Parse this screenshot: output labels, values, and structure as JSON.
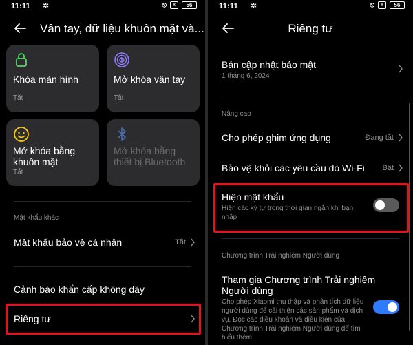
{
  "left": {
    "status": {
      "time": "11:11",
      "battery": "56"
    },
    "title": "Vân tay, dữ liệu khuôn mặt và...",
    "tiles": [
      {
        "label": "Khóa màn hình",
        "status": "Tắt",
        "icon": "lock-icon"
      },
      {
        "label": "Mở khóa vân tay",
        "status": "Tắt",
        "icon": "fingerprint-icon"
      },
      {
        "label": "Mở khóa bằng khuôn mặt",
        "status": "Tắt",
        "icon": "face-icon"
      },
      {
        "label": "Mở khóa bằng thiết bị Bluetooth",
        "icon": "bluetooth-icon"
      }
    ],
    "section_other": "Mật khẩu khác",
    "personal_password": {
      "label": "Mật khẩu bảo vệ cá nhân",
      "value": "Tắt"
    },
    "wireless_alert": {
      "label": "Cảnh báo khẩn cấp không dây"
    },
    "privacy": {
      "label": "Riêng tư"
    }
  },
  "right": {
    "status": {
      "time": "11:11",
      "battery": "56"
    },
    "title": "Riêng tư",
    "security_update": {
      "label": "Bản cập nhật bảo mật",
      "sub": "1 tháng 6, 2024"
    },
    "section_advanced": "Nâng cao",
    "app_pinning": {
      "label": "Cho phép ghim ứng dụng",
      "value": "Đang tắt"
    },
    "wifi_protect": {
      "label": "Bảo vệ khỏi các yêu cầu dò Wi-Fi",
      "value": "Bật"
    },
    "show_password": {
      "label": "Hiện mật khẩu",
      "sub": "Hiện các ký tự trong thời gian ngắn khi bạn nhập",
      "enabled": false
    },
    "section_ux": "Chương trình Trải nghiệm Người dùng",
    "join_program": {
      "label": "Tham gia Chương trình Trải nghiệm Người dùng",
      "sub": "Cho phép Xiaomi thu thập và phân tích dữ liệu người dùng để cải thiện các sản phẩm và dịch vụ. Đọc các điều khoản và điều kiện của Chương trình Trải nghiệm Người dùng để tìm hiểu thêm.",
      "enabled": true
    }
  },
  "colors": {
    "highlight": "#e0141e",
    "accent": "#2f7bff",
    "tile_icon_green": "#4cd964",
    "tile_icon_yellow": "#f5c518",
    "tile_icon_purple": "#8f7cff"
  }
}
